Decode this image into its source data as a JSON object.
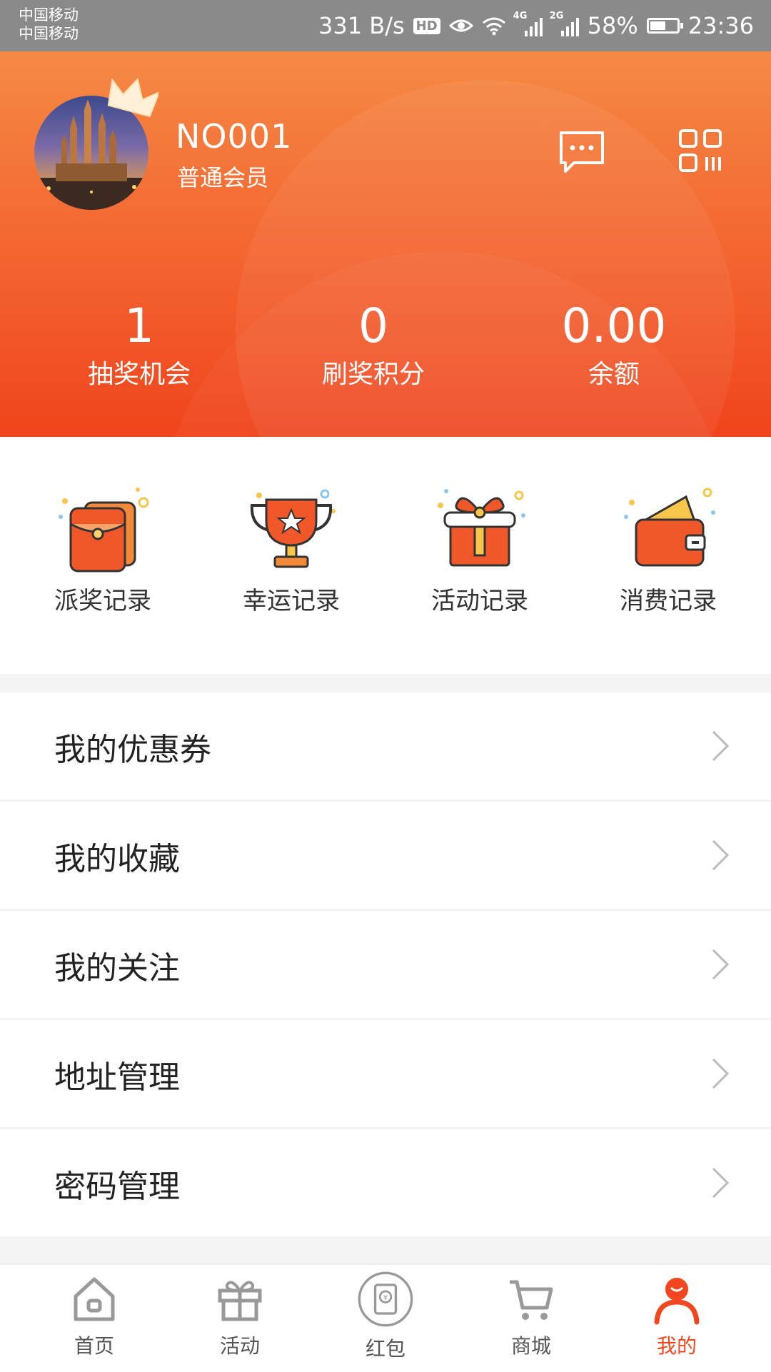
{
  "status_bar": {
    "carrier_1": "中国移动",
    "carrier_2": "中国移动",
    "speed": "331 B/s",
    "hd": "HD",
    "net_1": "4G",
    "net_2": "2G",
    "battery": "58%",
    "battery_level": 0.58,
    "time": "23:36"
  },
  "profile": {
    "username": "NO001",
    "level": "普通会员",
    "avatar_icon": "avatar-photo",
    "crown_icon": "crown-icon"
  },
  "header_actions": {
    "message_icon": "message-icon",
    "qr_icon": "qr-code-icon"
  },
  "stats": [
    {
      "value": "1",
      "label": "抽奖机会"
    },
    {
      "value": "0",
      "label": "刷奖积分"
    },
    {
      "value": "0.00",
      "label": "余额"
    }
  ],
  "records": [
    {
      "label": "派奖记录",
      "icon": "red-envelope-icon"
    },
    {
      "label": "幸运记录",
      "icon": "trophy-icon"
    },
    {
      "label": "活动记录",
      "icon": "gift-box-icon"
    },
    {
      "label": "消费记录",
      "icon": "wallet-icon"
    }
  ],
  "menu": [
    {
      "label": "我的优惠券"
    },
    {
      "label": "我的收藏"
    },
    {
      "label": "我的关注"
    },
    {
      "label": "地址管理"
    },
    {
      "label": "密码管理"
    }
  ],
  "tabs": [
    {
      "label": "首页",
      "icon": "home-icon"
    },
    {
      "label": "活动",
      "icon": "gift-icon"
    },
    {
      "label": "红包",
      "icon": "red-packet-icon"
    },
    {
      "label": "商城",
      "icon": "cart-icon"
    },
    {
      "label": "我的",
      "icon": "user-icon",
      "active": true
    }
  ],
  "colors": {
    "accent": "#f2461f",
    "header_top": "#f58a45",
    "header_bottom": "#f0441d"
  }
}
